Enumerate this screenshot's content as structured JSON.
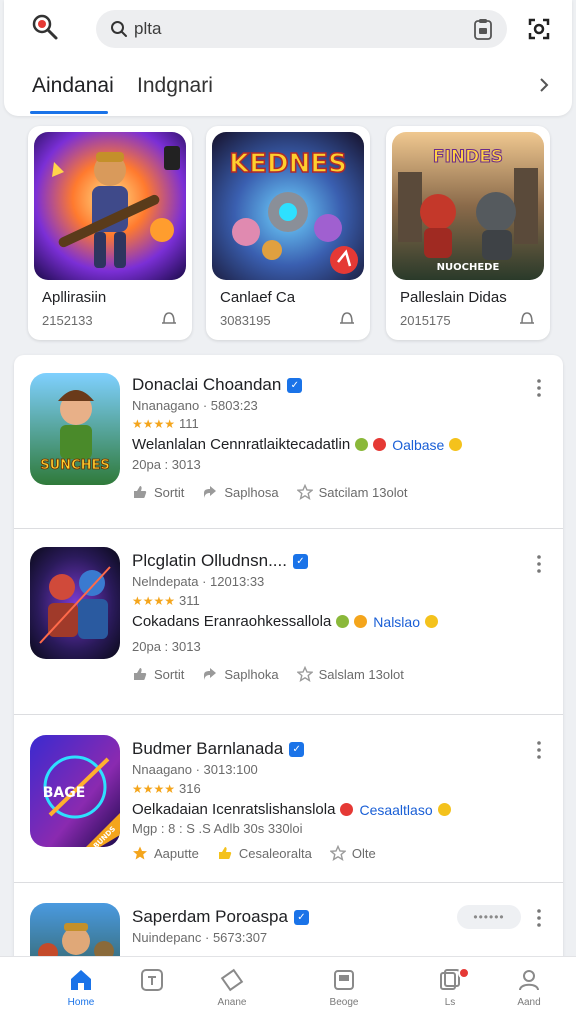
{
  "header": {
    "search_value": "plta",
    "tabs": [
      "Aindanai",
      "Indgnari"
    ],
    "icons": [
      "search-app-logo-icon",
      "search-icon",
      "clipboard-icon",
      "scan-icon",
      "chevron-right-icon"
    ]
  },
  "featured": [
    {
      "name": "Apllirasiin",
      "sub": "2152133"
    },
    {
      "name": "Canlaef Ca",
      "sub": "3083195",
      "art_title": "KEDNES"
    },
    {
      "name": "Palleslain Didas",
      "sub": "2015175",
      "art_title": "FINDES",
      "art_caption": "NUOCHEDE"
    }
  ],
  "list": [
    {
      "title": "Donaclai Choandan",
      "meta": "Nnanagano · 5803:23",
      "stars": "★★★★",
      "rating": "111",
      "desc": "Welanlalan Cennratlaiktecadatlin",
      "tag": "Oalbase",
      "date": "20pa : 3013",
      "art_title": "SUNCHES",
      "actions": [
        "Sortit",
        "Saplhosa",
        "Satcilam 13olot"
      ]
    },
    {
      "title": "Plcglatin Olludnsn....",
      "meta": "Nelndepata · 12013:33",
      "stars": "★★★★",
      "rating": "311",
      "desc": "Cokadans Eranraohkessallola",
      "tag": "Nalslao",
      "date": "20pa : 3013",
      "actions": [
        "Sortit",
        "Saplhoka",
        "Salslam 13olot"
      ]
    },
    {
      "title": "Budmer Barnlanada",
      "meta": "Nnaagano · 3013:100",
      "stars": "★★★★",
      "rating": "316",
      "desc": "Oelkadaian Icenratslishanslola",
      "tag": "Cesaaltlaso",
      "date": "Mgp : 8 : S .S Adlb 30s 330loi",
      "art_title": "BAGE",
      "art_ribbon": "BUNDS",
      "actions": [
        "Aaputte",
        "Cesaleoralta",
        "Olte"
      ]
    },
    {
      "title": "Saperdam Poroaspa",
      "meta": "Nuindepanc · 5673:307",
      "pill": "••••••"
    }
  ],
  "bottom_nav": [
    {
      "label": "Home",
      "active": true
    },
    {
      "label": "",
      "active": false
    },
    {
      "label": "Anane",
      "active": false
    },
    {
      "label": "Beoge",
      "active": false
    },
    {
      "label": "Ls",
      "active": false
    },
    {
      "label": "Aand",
      "active": false
    }
  ],
  "colors": {
    "accent": "#1a73e8",
    "star": "#f4a51c",
    "notif": "#e53935"
  }
}
